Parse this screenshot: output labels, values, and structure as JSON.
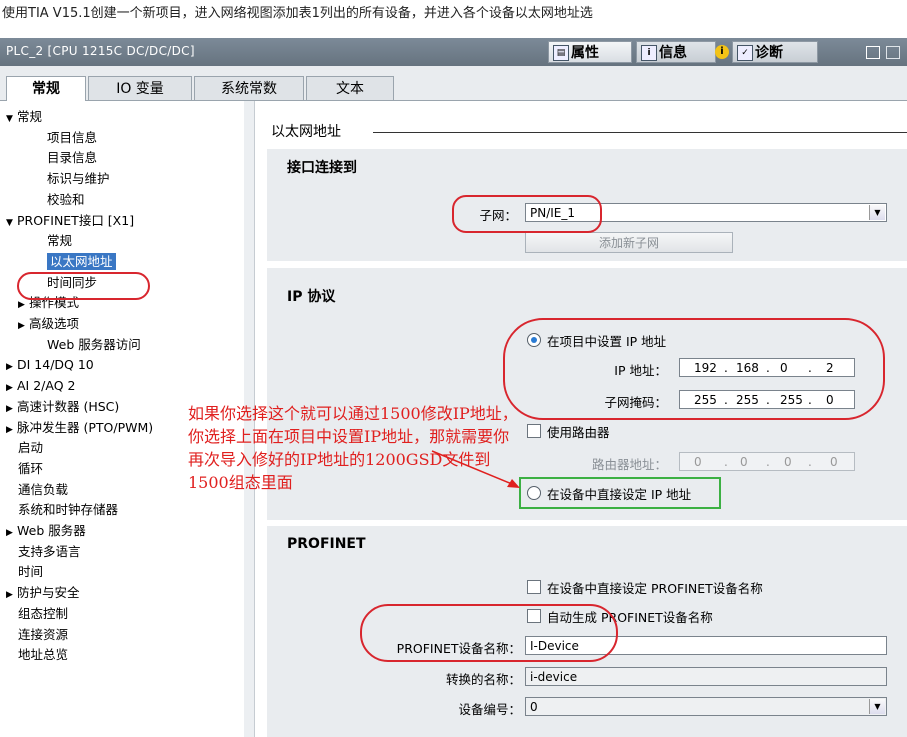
{
  "caption": "使用TIA V15.1创建一个新项目，进入网络视图添加表1列出的所有设备，并进入各个设备以太网地址选",
  "window": {
    "title": "PLC_2 [CPU 1215C DC/DC/DC]",
    "right_tabs": [
      {
        "label": "属性",
        "icon": "properties-icon"
      },
      {
        "label": "信息",
        "icon": "info-icon"
      },
      {
        "label": "诊断",
        "icon": "diagnostics-icon"
      }
    ]
  },
  "tabs": [
    "常规",
    "IO 变量",
    "系统常数",
    "文本"
  ],
  "tree": [
    {
      "label": "常规",
      "level": 0,
      "expanded": true
    },
    {
      "label": "项目信息",
      "level": 2
    },
    {
      "label": "目录信息",
      "level": 2
    },
    {
      "label": "标识与维护",
      "level": 2
    },
    {
      "label": "校验和",
      "level": 2
    },
    {
      "label": "PROFINET接口 [X1]",
      "level": 0,
      "expanded": true
    },
    {
      "label": "常规",
      "level": 2
    },
    {
      "label": "以太网地址",
      "level": 2,
      "selected": true
    },
    {
      "label": "时间同步",
      "level": 2
    },
    {
      "label": "操作模式",
      "level": 1,
      "collapsed": true
    },
    {
      "label": "高级选项",
      "level": 1,
      "collapsed": true
    },
    {
      "label": "Web 服务器访问",
      "level": 2
    },
    {
      "label": "DI 14/DQ 10",
      "level": 0,
      "collapsed": true
    },
    {
      "label": "AI 2/AQ 2",
      "level": 0,
      "collapsed": true
    },
    {
      "label": "高速计数器 (HSC)",
      "level": 0,
      "collapsed": true
    },
    {
      "label": "脉冲发生器 (PTO/PWM)",
      "level": 0,
      "collapsed": true
    },
    {
      "label": "启动",
      "level": 1
    },
    {
      "label": "循环",
      "level": 1
    },
    {
      "label": "通信负载",
      "level": 1
    },
    {
      "label": "系统和时钟存储器",
      "level": 1
    },
    {
      "label": "Web 服务器",
      "level": 0,
      "collapsed": true
    },
    {
      "label": "支持多语言",
      "level": 1
    },
    {
      "label": "时间",
      "level": 1
    },
    {
      "label": "防护与安全",
      "level": 0,
      "collapsed": true
    },
    {
      "label": "组态控制",
      "level": 1
    },
    {
      "label": "连接资源",
      "level": 1
    },
    {
      "label": "地址总览",
      "level": 1
    }
  ],
  "content": {
    "header": "以太网地址",
    "interface": {
      "title": "接口连接到",
      "subnet_label": "子网：",
      "subnet_value": "PN/IE_1",
      "add_subnet_button": "添加新子网"
    },
    "ip": {
      "title": "IP 协议",
      "option_project": "在项目中设置 IP 地址",
      "ip_label": "IP 地址：",
      "ip_octets": [
        "192",
        "168",
        "0",
        "2"
      ],
      "mask_label": "子网掩码：",
      "mask_octets": [
        "255",
        "255",
        "255",
        "0"
      ],
      "use_router": "使用路由器",
      "router_label": "路由器地址：",
      "router_octets": [
        "0",
        "0",
        "0",
        "0"
      ],
      "option_device": "在设备中直接设定 IP 地址"
    },
    "profinet": {
      "title": "PROFINET",
      "set_name_in_device": "在设备中直接设定 PROFINET设备名称",
      "auto_generate": "自动生成 PROFINET设备名称",
      "name_label": "PROFINET设备名称：",
      "name_value": "I-Device",
      "converted_label": "转换的名称：",
      "converted_value": "i-device",
      "number_label": "设备编号：",
      "number_value": "0"
    }
  },
  "annotation": "如果你选择这个就可以通过1500修改IP地址，你选择上面在项目中设置IP地址，那就需要你再次导入修好的IP地址的1200GSD文件到1500组态里面",
  "colors": {
    "annotation_red": "#d8262e",
    "highlight_green": "#3cb043",
    "radio_blue": "#2a7bd3"
  }
}
